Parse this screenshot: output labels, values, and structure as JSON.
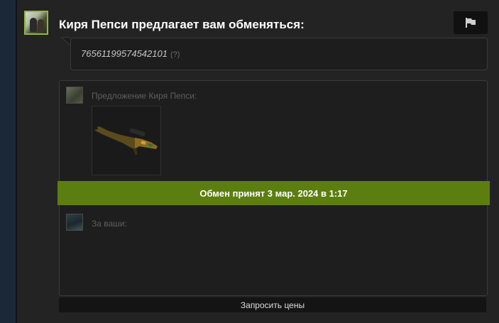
{
  "offer": {
    "headline": "Киря Пепси предлагает вам обменяться:",
    "steam_id": "76561199574542101",
    "help_mark": "(?)"
  },
  "trade": {
    "their_offer_label": "Предложение Киря Пепси:",
    "yours_label": "За ваши:",
    "status": "Обмен принят 3 мар. 2024 в 1:17",
    "status_color": "#5c7e10"
  },
  "actions": {
    "request_prices_label": "Запросить цены"
  },
  "icons": {
    "report": "flag-icon",
    "item": "sniper-rifle-icon"
  }
}
